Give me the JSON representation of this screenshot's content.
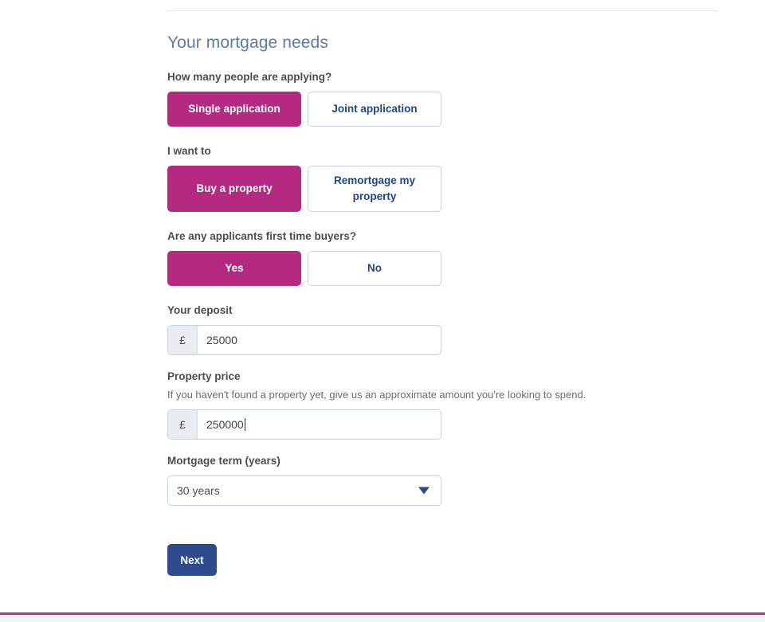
{
  "form": {
    "section_title": "Your mortgage needs",
    "groups": [
      {
        "label": "How many people are applying?",
        "help": "",
        "type": "toggle",
        "options": [
          {
            "text": "Single application",
            "selected": true
          },
          {
            "text": "Joint application",
            "selected": false
          }
        ]
      },
      {
        "label": "I want to",
        "help": "",
        "type": "toggle",
        "options": [
          {
            "text": "Buy a property",
            "selected": true
          },
          {
            "text": "Remortgage my property",
            "selected": false
          }
        ]
      },
      {
        "label": "Are any applicants first time buyers?",
        "help": "",
        "type": "toggle",
        "options": [
          {
            "text": "Yes",
            "selected": true
          },
          {
            "text": "No",
            "selected": false
          }
        ]
      },
      {
        "label": "Your deposit",
        "help": "",
        "type": "currency",
        "prefix": "£",
        "value": "25000",
        "focused": false
      },
      {
        "label": "Property price",
        "help": "If you haven't found a property yet, give us an approximate amount you're looking to spend.",
        "type": "currency",
        "prefix": "£",
        "value": "250000",
        "focused": true
      },
      {
        "label": "Mortgage term (years)",
        "help": "",
        "type": "select",
        "value": "30 years",
        "icon": "chevron-down-icon"
      }
    ],
    "submit_label": "Next"
  },
  "colors": {
    "accent_magenta": "#b42a81",
    "accent_navy": "#2e4b8d",
    "heading_blue": "#5c7ba6",
    "border_blue": "#c6d3e6",
    "prefix_gray": "#e9ecef",
    "footer_magenta": "#c02b86"
  }
}
